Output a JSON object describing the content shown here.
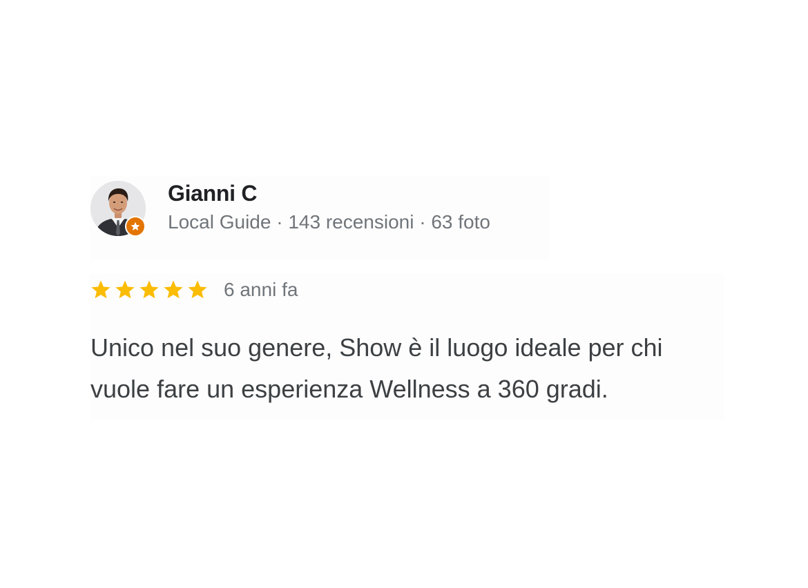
{
  "review": {
    "author": {
      "name": "Gianni C",
      "level": "Local Guide",
      "separator": "·",
      "reviews_count": "143 recensioni",
      "photos_count": "63 foto",
      "avatar_icon": "user-photo",
      "badge_icon": "local-guide-star-badge",
      "badge_color": "#e37400"
    },
    "rating": {
      "stars": 5,
      "max_stars": 5,
      "star_color": "#fbbc04",
      "time_ago": "6 anni fa"
    },
    "text": "Unico nel suo genere, Show è il luogo ideale per chi vuole fare un esperienza Wellness a 360 gradi."
  }
}
